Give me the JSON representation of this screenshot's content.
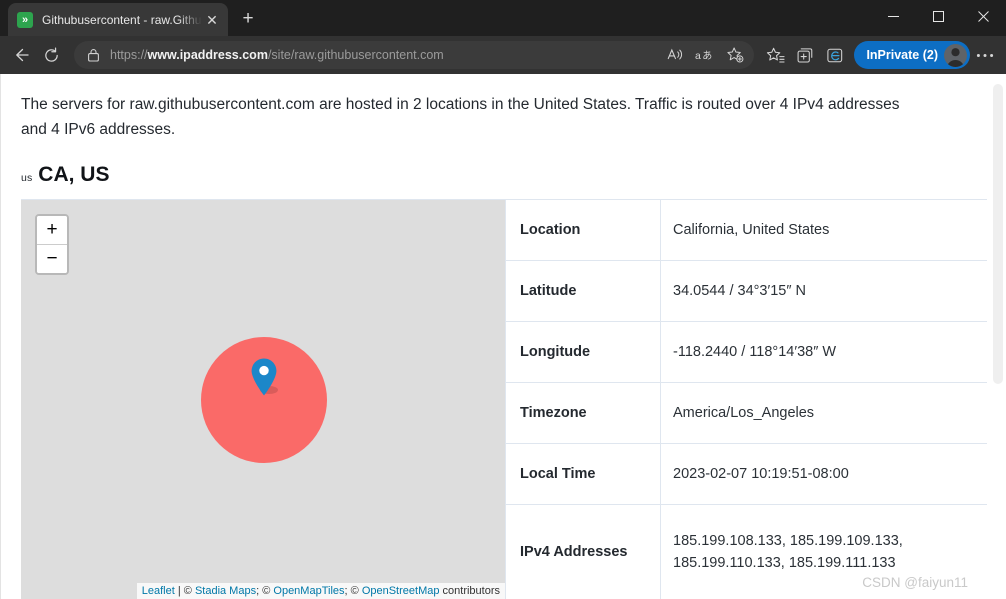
{
  "browser": {
    "tab": {
      "title": "Githubusercontent - raw.Githubu",
      "favicon_glyph": "»",
      "close_glyph": "✕"
    },
    "new_tab_glyph": "+",
    "window_controls": {
      "minimize": "minimize-icon",
      "maximize": "maximize-icon",
      "close": "close-icon"
    },
    "nav": {
      "back": "back-arrow-icon",
      "reload": "reload-icon"
    },
    "url": {
      "scheme": "https://",
      "domain": "www.ipaddress.com",
      "path": "/site/raw.githubusercontent.com",
      "full": "https://www.ipaddress.com/site/raw.githubusercontent.com"
    },
    "toolbar_icons": {
      "read_aloud": "read-aloud-icon",
      "translate": "translate-icon",
      "add_favorite": "add-favorite-icon",
      "favorites": "favorites-icon",
      "collections": "collections-icon",
      "browser_essentials": "browser-essentials-icon",
      "settings_more": "more-options-icon"
    },
    "profile": {
      "label": "InPrivate (2)",
      "accent_color": "#0d6ec4"
    }
  },
  "page": {
    "intro": "The servers for raw.githubusercontent.com are hosted in 2 locations in the United States. Traffic is routed over 4 IPv4 addresses and 4 IPv6 addresses.",
    "location_heading": {
      "flag_alt": "us",
      "title": "CA, US"
    },
    "map": {
      "zoom_in_label": "+",
      "zoom_out_label": "−",
      "background_color": "#dddddd",
      "circle_color": "#fa6a68",
      "pin_color": "#1c87c9",
      "attribution": {
        "leaflet": "Leaflet",
        "separator": " | ",
        "stadia": "Stadia Maps",
        "openmaptiles": "OpenMapTiles",
        "openstreetmap": "OpenStreetMap",
        "suffix": " contributors",
        "copyright": "©"
      }
    },
    "details": [
      {
        "label": "Location",
        "value": "California, United States"
      },
      {
        "label": "Latitude",
        "value": "34.0544 / 34°3′15″ N"
      },
      {
        "label": "Longitude",
        "value": "-118.2440 / 118°14′38″ W"
      },
      {
        "label": "Timezone",
        "value": "America/Los_Angeles"
      },
      {
        "label": "Local Time",
        "value": "2023-02-07 10:19:51-08:00"
      }
    ],
    "ipv4_row": {
      "label": "IPv4 Addresses",
      "line1": "185.199.108.133, 185.199.109.133,",
      "line2": "185.199.110.133, 185.199.111.133"
    }
  },
  "watermark": "CSDN @faiyun11"
}
